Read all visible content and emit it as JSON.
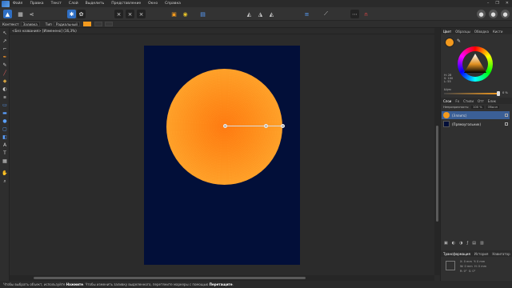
{
  "menubar": {
    "items": [
      "Файл",
      "Правка",
      "Текст",
      "Слой",
      "Выделить",
      "Представление",
      "Окно",
      "Справка"
    ],
    "window_controls": [
      "–",
      "❐",
      "✕"
    ]
  },
  "context": {
    "label_context": "Контекст",
    "context_value": "Заливка",
    "label_type": "Тип",
    "type_value": "Радиальный"
  },
  "document": {
    "tab_title": "<Без названия> [Изменено] (16,3%)"
  },
  "panels": {
    "color_tabs": [
      "Цвет",
      "Образцы",
      "Обводка",
      "Кисти"
    ],
    "hsl_lines": [
      "Н: 28",
      "S: 100",
      "L: 55"
    ],
    "opacity_label": "Шум",
    "opacity_value": "0 %",
    "layer_tabs": [
      "Слои",
      "Fx",
      "Стили",
      "Отт",
      "Блик"
    ],
    "layer_opacity_label": "Непрозрачность:",
    "layer_opacity_value": "100 %",
    "blend_mode": "Обычн",
    "layers": [
      {
        "name": "(Эллипс)",
        "selected": true,
        "thumb_color": "#f39a1e"
      },
      {
        "name": "(Прямоугольник)",
        "selected": false,
        "thumb_color": "#020f39"
      }
    ],
    "transform_tabs": [
      "Трансформация",
      "История",
      "Навигатор"
    ],
    "transform_fields": [
      "X: 0 mm",
      "Y: 0 mm",
      "W: 0 mm",
      "H: 0 mm",
      "R: 0°",
      "S: 0°"
    ]
  },
  "statusbar": {
    "prefix": "Чтобы выбрать объект, используйте ",
    "click_word": "Нажмите",
    "middle": ". Чтобы изменить заливку выделенного, перетяните маркеры с помощью ",
    "drag_word": "Перетащите",
    "suffix": "."
  },
  "colors": {
    "accent": "#2f6fc4",
    "fill": "#f39a1e",
    "artboard": "#020f39"
  }
}
